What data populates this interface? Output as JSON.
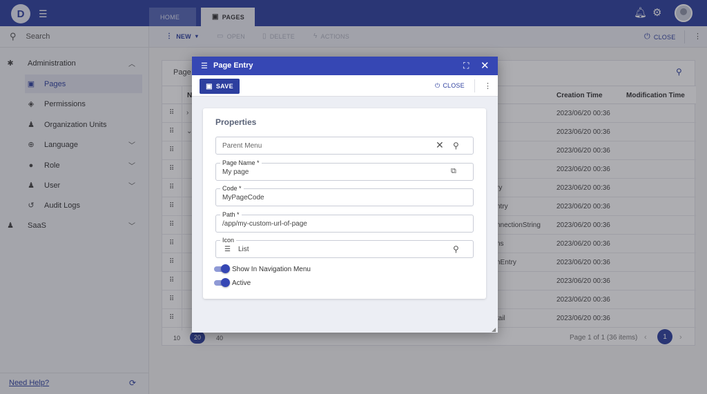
{
  "topbar": {
    "logo_letter": "D",
    "tabs": [
      {
        "label": "HOME"
      },
      {
        "label": "PAGES"
      }
    ]
  },
  "sidebar": {
    "search_placeholder": "Search",
    "items": [
      {
        "label": "Administration",
        "icon": "gear-icon"
      },
      {
        "label": "Pages",
        "icon": "pages-icon"
      },
      {
        "label": "Permissions",
        "icon": "lock-icon"
      },
      {
        "label": "Organization Units",
        "icon": "users-icon"
      },
      {
        "label": "Language",
        "icon": "globe-icon"
      },
      {
        "label": "Role",
        "icon": "role-icon"
      },
      {
        "label": "User",
        "icon": "user-icon"
      },
      {
        "label": "Audit Logs",
        "icon": "history-icon"
      },
      {
        "label": "SaaS",
        "icon": "saas-icon"
      }
    ],
    "need_help": "Need Help?"
  },
  "toolbar": {
    "new_label": "NEW",
    "open_label": "OPEN",
    "delete_label": "DELETE",
    "actions_label": "ACTIONS",
    "close_label": "CLOSE"
  },
  "grid": {
    "title": "Page",
    "columns": {
      "name": "N",
      "creation": "Creation Time",
      "modification": "Modification Time"
    },
    "rows": [
      {
        "name": "",
        "creation_time": "2023/06/20 00:36"
      },
      {
        "name": "",
        "creation_time": "2023/06/20 00:36"
      },
      {
        "name": "",
        "creation_time": "2023/06/20 00:36"
      },
      {
        "name": "",
        "creation_time": "2023/06/20 00:36"
      },
      {
        "name": "ry",
        "creation_time": "2023/06/20 00:36"
      },
      {
        "name": "ntry",
        "creation_time": "2023/06/20 00:36"
      },
      {
        "name": "nnectionString",
        "creation_time": "2023/06/20 00:36"
      },
      {
        "name": "ns",
        "creation_time": "2023/06/20 00:36"
      },
      {
        "name": "nEntry",
        "creation_time": "2023/06/20 00:36"
      },
      {
        "name": "",
        "creation_time": "2023/06/20 00:36"
      },
      {
        "name": "",
        "creation_time": "2023/06/20 00:36"
      },
      {
        "name": "tail",
        "creation_time": "2023/06/20 00:36"
      }
    ],
    "page_sizes": [
      "10",
      "20",
      "40"
    ],
    "pager_info": "Page 1 of 1 (36 items)",
    "current_page": "1"
  },
  "modal": {
    "title": "Page Entry",
    "save_label": "SAVE",
    "close_label": "CLOSE",
    "section_title": "Properties",
    "parent_menu_placeholder": "Parent Menu",
    "page_name": {
      "label": "Page Name *",
      "value": "My page"
    },
    "code": {
      "label": "Code *",
      "value": "MyPageCode"
    },
    "path": {
      "label": "Path *",
      "value": "/app/my-custom-url-of-page"
    },
    "icon": {
      "label": "Icon",
      "value": "List"
    },
    "show_in_nav_label": "Show In Navigation Menu",
    "active_label": "Active",
    "show_in_nav_checked": true,
    "active_checked": true
  },
  "colors": {
    "primary": "#2d3f9f",
    "modal_header": "#3647b4"
  }
}
